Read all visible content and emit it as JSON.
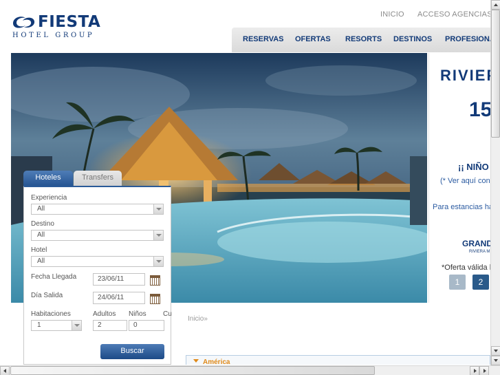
{
  "logo": {
    "name": "FIESTA",
    "subtitle": "HOTEL GROUP"
  },
  "top_links": [
    "INICIO",
    "ACCESO AGENCIAS"
  ],
  "nav": [
    "RESERVAS",
    "OFERTAS",
    "RESORTS",
    "DESTINOS",
    "PROFESIONA"
  ],
  "promo": {
    "title": "RIVIEF",
    "number": "15",
    "kids": "¡¡ NIÑO",
    "note": "(* Ver aquí con",
    "stays": "Para estancias ha",
    "hotel": "GRAND",
    "hotel_sub": "RIVIERA M",
    "valid": "*Oferta válida h",
    "pages": [
      "1",
      "2"
    ]
  },
  "search": {
    "tabs": [
      "Hoteles",
      "Transfers"
    ],
    "experiencia_label": "Experiencia",
    "experiencia_value": "All",
    "destino_label": "Destino",
    "destino_value": "All",
    "hotel_label": "Hotel",
    "hotel_value": "All",
    "llegada_label": "Fecha Llegada",
    "llegada_value": "23/06/11",
    "salida_label": "Día Salida",
    "salida_value": "24/06/11",
    "habitaciones_label": "Habitaciones",
    "habitaciones_value": "1",
    "adultos_label": "Adultos",
    "adultos_value": "2",
    "ninos_label": "Niños",
    "ninos_value": "0",
    "extra_label": "Cu",
    "button": "Buscar"
  },
  "breadcrumb": "Inicio»",
  "accordion": {
    "label": "América"
  },
  "colors": {
    "brand": "#123a78",
    "accent": "#e08a1a",
    "tab_active": "#2a5a98"
  }
}
